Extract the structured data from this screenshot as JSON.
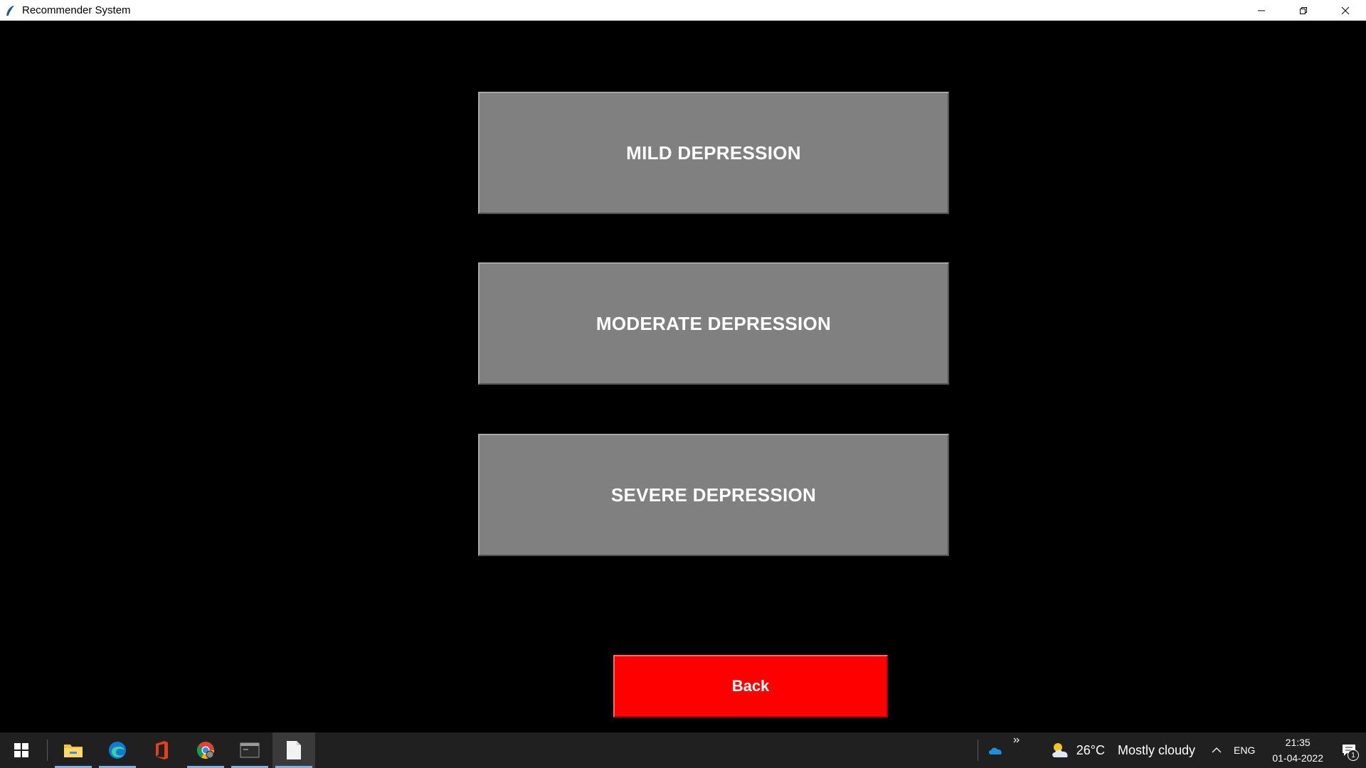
{
  "window": {
    "title": "Recommender System",
    "controls": {
      "minimize": "minimize",
      "restore": "restore",
      "close": "close"
    }
  },
  "main": {
    "buttons": [
      {
        "label": "MILD DEPRESSION"
      },
      {
        "label": "MODERATE DEPRESSION"
      },
      {
        "label": "SEVERE DEPRESSION"
      }
    ],
    "back_label": "Back",
    "colors": {
      "background": "#000000",
      "level_button": "#808080",
      "back_button": "#ff0000",
      "text": "#ffffff"
    }
  },
  "taskbar": {
    "apps": [
      {
        "icon": "file-explorer-icon"
      },
      {
        "icon": "edge-icon"
      },
      {
        "icon": "office-icon"
      },
      {
        "icon": "chrome-icon"
      },
      {
        "icon": "terminal-icon"
      },
      {
        "icon": "document-icon",
        "active": true
      }
    ],
    "weather": {
      "temp": "26°C",
      "condition": "Mostly cloudy"
    },
    "language": "ENG",
    "time": "21:35",
    "date": "01-04-2022",
    "notification_count": "1"
  }
}
